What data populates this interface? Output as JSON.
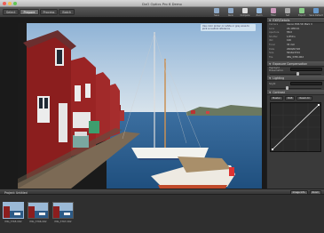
{
  "window": {
    "title": "DxO Optics Pro 6 Demo"
  },
  "tabs": [
    "Select",
    "Prepare",
    "Process",
    "Batch"
  ],
  "active_tab": 1,
  "toolbar_icons": [
    {
      "label": "Save",
      "icon": "save-icon"
    },
    {
      "label": "Redo",
      "icon": "redo-icon"
    },
    {
      "label": "Compare",
      "icon": "compare-icon"
    },
    {
      "label": "Zoom",
      "icon": "zoom-icon"
    },
    {
      "label": "Filter",
      "icon": "filter-icon"
    },
    {
      "label": "Set",
      "icon": "settings-icon"
    },
    {
      "label": "Export",
      "icon": "export-icon"
    },
    {
      "label": "Save Default",
      "icon": "save-default-icon"
    }
  ],
  "tooltip": "Use color picker on white or grey area to pick a neutral reference",
  "sidebar": {
    "metadata_title": "EXIF/Details",
    "metadata": [
      {
        "k": "Camera",
        "v": "Canon EOS 5D Mark II"
      },
      {
        "k": "Lens",
        "v": "24-105mm"
      },
      {
        "k": "Aperture",
        "v": "f/8.0"
      },
      {
        "k": "Shutter",
        "v": "1/250 s"
      },
      {
        "k": "ISO",
        "v": "100"
      },
      {
        "k": "Focal",
        "v": "35 mm"
      },
      {
        "k": "Date",
        "v": "2009/07/18"
      },
      {
        "k": "Size",
        "v": "5616x3744"
      },
      {
        "k": "File",
        "v": "IMG_3765.CR2"
      }
    ],
    "exposure_title": "Exposure Compensation",
    "exposure_field": "Highlight Preservation",
    "lighting_title": "Lighting",
    "lighting_field": "Slight",
    "contrast_title": "Contrast",
    "curve_btns": [
      "Master",
      "RGB",
      "Reset All"
    ]
  },
  "bottombar": {
    "label": "Project: Untitled",
    "buttons": [
      "Image Info",
      "Zoom"
    ]
  },
  "filmstrip": [
    {
      "name": "IMG_3765.CR2",
      "selected": true
    },
    {
      "name": "IMG_3766.CR2",
      "selected": false
    },
    {
      "name": "IMG_3767.CR2",
      "selected": false
    }
  ]
}
